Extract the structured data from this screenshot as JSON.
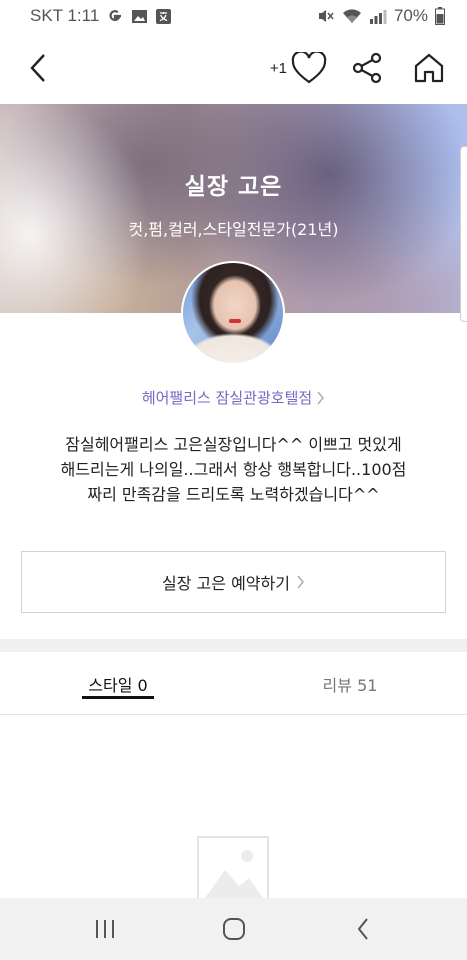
{
  "status_bar": {
    "carrier_time": "SKT 1:11",
    "battery": "70%",
    "icons": [
      "google-icon",
      "image-icon",
      "translate-icon",
      "mute-icon",
      "wifi-icon",
      "signal-icon",
      "battery-icon"
    ]
  },
  "nav": {
    "back_icon": "chevron-left-icon",
    "like_count": "+1",
    "like_icon": "heart-icon",
    "share_icon": "share-icon",
    "home_icon": "home-icon"
  },
  "profile": {
    "name": "실장 고은",
    "specialty": "컷,펌,컬러,스타일전문가(21년)",
    "salon": "헤어팰리스 잠실관광호텔점",
    "bio": "잠실헤어팰리스 고은실장입니다^^ 이쁘고 멋있게해드리는게 나의일..그래서 항상 행복합니다..100점짜리 만족감을 드리도록 노력하겠습니다^^"
  },
  "reserve_button": {
    "label": "실장 고은 예약하기"
  },
  "tabs": [
    {
      "label": "스타일 0",
      "active": true
    },
    {
      "label": "리뷰 51",
      "active": false
    }
  ],
  "empty_state": {
    "icon": "image-placeholder-icon"
  },
  "system_nav": {
    "icons": [
      "recent-apps-icon",
      "home-circle-icon",
      "back-icon"
    ]
  },
  "colors": {
    "accent": "#7a66c4",
    "text": "#222222",
    "divider": "#f0f0f0",
    "system_bar": "#f1f1f1"
  }
}
